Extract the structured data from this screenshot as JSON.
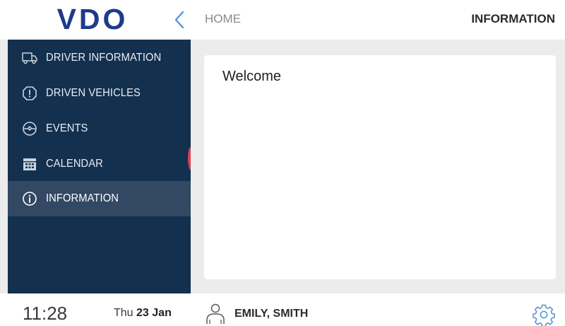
{
  "header": {
    "logo_text": "VDO",
    "back_icon": "chevron-left-icon",
    "breadcrumb": "HOME",
    "title": "INFORMATION"
  },
  "sidebar": {
    "items": [
      {
        "label": "DRIVER INFORMATION",
        "icon": "truck-icon",
        "active": false
      },
      {
        "label": "DRIVEN VEHICLES",
        "icon": "alert-icon",
        "active": false
      },
      {
        "label": "EVENTS",
        "icon": "events-icon",
        "active": false
      },
      {
        "label": "CALENDAR",
        "icon": "calendar-icon",
        "active": false
      },
      {
        "label": "INFORMATION",
        "icon": "info-icon",
        "active": true
      }
    ]
  },
  "main": {
    "welcome_text": "Welcome"
  },
  "footer": {
    "time": "11:28",
    "day": "Thu",
    "date": "23 Jan",
    "user_icon": "user-icon",
    "user_name": "EMILY, SMITH",
    "settings_icon": "gear-icon"
  },
  "colors": {
    "brand": "#1f3a8a",
    "sidebar_bg": "#13304f",
    "sidebar_active": "#324863",
    "accent": "#4a90d9",
    "marker": "#e0405a"
  }
}
